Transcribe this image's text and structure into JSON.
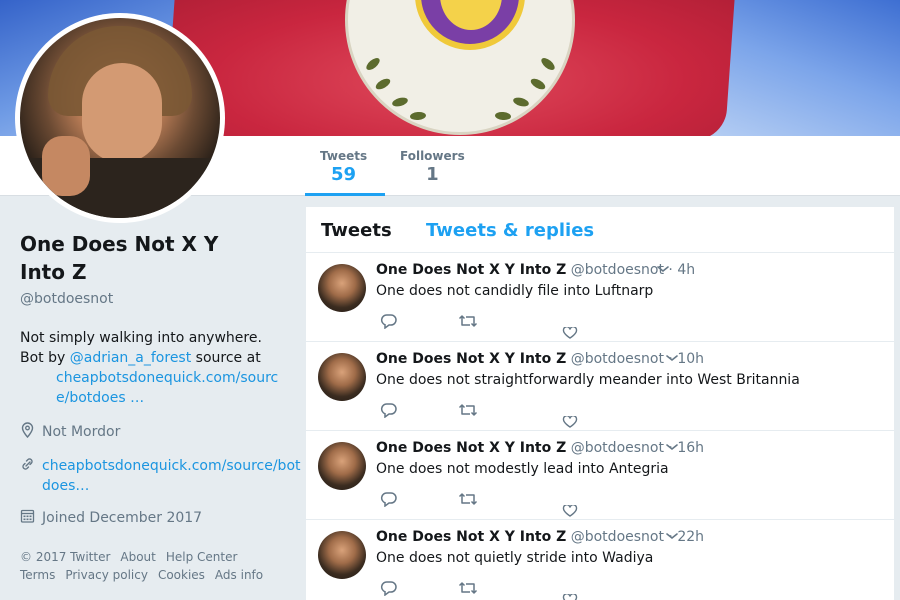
{
  "profile": {
    "display_name": "One Does Not X Y Into Z",
    "handle": "@botdoesnot",
    "bio_line1": "Not simply walking into anywhere.",
    "bio_by": "Bot by ",
    "bio_author": "@adrian_a_forest",
    "bio_source": " source at",
    "bio_url": "cheapbotsdonequick.com/source/botdoes …",
    "location": "Not Mordor",
    "website": "cheapbotsdonequick.com/source/botdoes…",
    "joined": "Joined December 2017"
  },
  "stats": {
    "tweets_label": "Tweets",
    "tweets_value": "59",
    "followers_label": "Followers",
    "followers_value": "1"
  },
  "footer": {
    "items": [
      "© 2017 Twitter",
      "About",
      "Help Center",
      "Terms",
      "Privacy policy",
      "Cookies",
      "Ads info"
    ]
  },
  "timeline": {
    "tabs": [
      "Tweets",
      "Tweets & replies"
    ],
    "tweets": [
      {
        "name": "One Does Not X Y Into Z",
        "handle": "@botdoesnot",
        "time": "· 4h",
        "text": "One does not candidly file into Luftnarp"
      },
      {
        "name": "One Does Not X Y Into Z",
        "handle": "@botdoesnot",
        "time": "· 10h",
        "text": "One does not straightforwardly meander into West Britannia"
      },
      {
        "name": "One Does Not X Y Into Z",
        "handle": "@botdoesnot",
        "time": "· 16h",
        "text": "One does not modestly lead into Antegria"
      },
      {
        "name": "One Does Not X Y Into Z",
        "handle": "@botdoesnot",
        "time": "· 22h",
        "text": "One does not quietly stride into Wadiya"
      }
    ]
  },
  "icons": {
    "location": "map-pin-icon",
    "link": "link-icon",
    "calendar": "calendar-icon",
    "reply": "reply-icon",
    "retweet": "retweet-icon",
    "like": "heart-icon",
    "caret": "chevron-down-icon"
  },
  "colors": {
    "accent": "#1da1f2",
    "link": "#1b95e0",
    "muted": "#657786",
    "background": "#e6ecf0"
  }
}
